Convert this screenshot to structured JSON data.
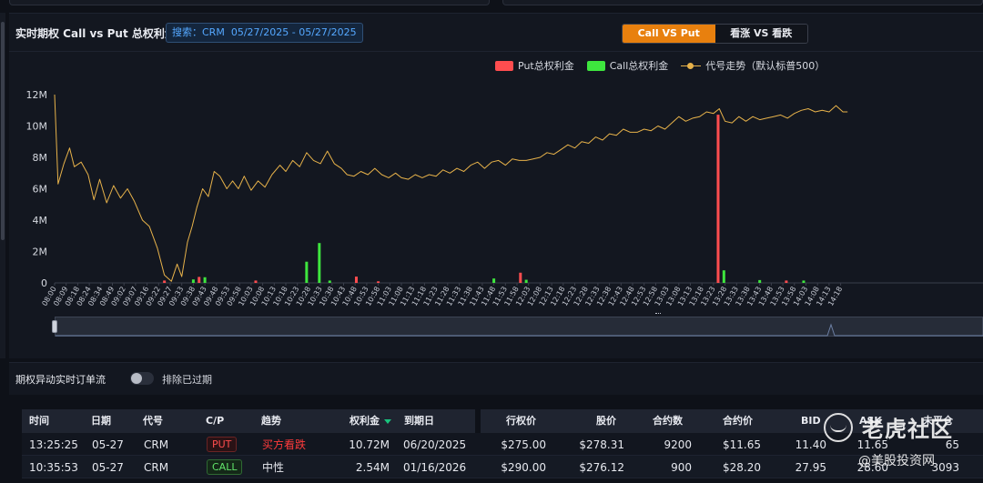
{
  "panel": {
    "title": "实时期权 Call vs Put 总权利金",
    "search_label": "搜索：CRM",
    "date_range": "05/27/2025 - 05/27/2025",
    "seg_active": "Call VS Put",
    "seg_inactive": "看涨 VS 看跌"
  },
  "legend": {
    "put": "Put总权利金",
    "call": "Call总权利金",
    "stock": "代号走势（默认标普500）"
  },
  "colors": {
    "put": "#ff4d4f",
    "call": "#3ee63e",
    "stock": "#e7b24a",
    "accent": "#e8800e"
  },
  "chart_data": {
    "type": "bar",
    "y_ticks": [
      "0",
      "2M",
      "4M",
      "6M",
      "8M",
      "10M",
      "12M"
    ],
    "ylim": [
      0,
      12000000
    ],
    "x_ticks": [
      "08:00",
      "08:09",
      "08:18",
      "08:24",
      "08:34",
      "08:49",
      "09:02",
      "09:07",
      "09:16",
      "09:22",
      "09:27",
      "09:33",
      "09:38",
      "09:43",
      "09:48",
      "09:53",
      "09:58",
      "10:03",
      "10:08",
      "10:13",
      "10:18",
      "10:23",
      "10:28",
      "10:33",
      "10:38",
      "10:43",
      "10:48",
      "10:53",
      "10:58",
      "11:03",
      "11:08",
      "11:13",
      "11:18",
      "11:23",
      "11:28",
      "11:33",
      "11:38",
      "11:43",
      "11:48",
      "11:53",
      "11:58",
      "12:03",
      "12:08",
      "12:13",
      "12:18",
      "12:23",
      "12:28",
      "12:33",
      "12:38",
      "12:43",
      "12:48",
      "12:53",
      "12:58",
      "13:03",
      "13:08",
      "13:13",
      "13:18",
      "13:23",
      "13:28",
      "13:33",
      "13:38",
      "13:43",
      "13:48",
      "13:53",
      "13:58",
      "14:03",
      "14:08",
      "14:13",
      "14:18"
    ],
    "series": [
      {
        "name": "Put总权利金",
        "points": [
          [
            9.5,
            150000
          ],
          [
            12.5,
            380000
          ],
          [
            17.4,
            150000
          ],
          [
            26.1,
            400000
          ],
          [
            28.0,
            100000
          ],
          [
            40.3,
            650000
          ],
          [
            57.4,
            10720000
          ],
          [
            63.3,
            150000
          ]
        ]
      },
      {
        "name": "Call总权利金",
        "points": [
          [
            12.0,
            220000
          ],
          [
            13.0,
            360000
          ],
          [
            21.8,
            1350000
          ],
          [
            22.9,
            2540000
          ],
          [
            23.8,
            150000
          ],
          [
            38.0,
            280000
          ],
          [
            40.8,
            200000
          ],
          [
            57.9,
            800000
          ],
          [
            61.0,
            180000
          ],
          [
            64.8,
            150000
          ]
        ]
      },
      {
        "name": "代号走势（默认标普500）",
        "points": [
          [
            0,
            12.0
          ],
          [
            0.3,
            6.3
          ],
          [
            0.8,
            7.6
          ],
          [
            1.3,
            8.6
          ],
          [
            1.7,
            7.4
          ],
          [
            2.3,
            7.7
          ],
          [
            2.9,
            6.9
          ],
          [
            3.4,
            5.3
          ],
          [
            3.9,
            6.6
          ],
          [
            4.5,
            5.1
          ],
          [
            5.1,
            6.2
          ],
          [
            5.7,
            5.4
          ],
          [
            6.3,
            6.0
          ],
          [
            6.9,
            5.2
          ],
          [
            7.6,
            4.0
          ],
          [
            8.2,
            3.6
          ],
          [
            8.9,
            2.2
          ],
          [
            9.5,
            0.5
          ],
          [
            10.1,
            0.1
          ],
          [
            10.6,
            1.2
          ],
          [
            11.0,
            0.4
          ],
          [
            11.5,
            2.6
          ],
          [
            11.9,
            3.6
          ],
          [
            12.3,
            4.8
          ],
          [
            12.8,
            6.0
          ],
          [
            13.3,
            5.5
          ],
          [
            13.8,
            7.1
          ],
          [
            14.3,
            6.8
          ],
          [
            14.9,
            6.0
          ],
          [
            15.4,
            6.5
          ],
          [
            15.9,
            6.0
          ],
          [
            16.4,
            6.8
          ],
          [
            17.0,
            5.9
          ],
          [
            17.6,
            6.5
          ],
          [
            18.2,
            6.1
          ],
          [
            18.8,
            6.9
          ],
          [
            19.5,
            7.5
          ],
          [
            20.0,
            7.1
          ],
          [
            20.6,
            7.8
          ],
          [
            21.2,
            7.4
          ],
          [
            21.8,
            8.3
          ],
          [
            22.4,
            7.8
          ],
          [
            23.0,
            7.6
          ],
          [
            23.6,
            8.4
          ],
          [
            24.2,
            7.6
          ],
          [
            24.8,
            7.3
          ],
          [
            25.3,
            6.9
          ],
          [
            25.9,
            6.8
          ],
          [
            26.5,
            7.1
          ],
          [
            27.1,
            6.9
          ],
          [
            27.7,
            7.3
          ],
          [
            28.3,
            6.9
          ],
          [
            28.9,
            6.7
          ],
          [
            29.5,
            7.0
          ],
          [
            30.0,
            6.7
          ],
          [
            30.6,
            6.6
          ],
          [
            31.2,
            6.9
          ],
          [
            31.8,
            6.7
          ],
          [
            32.4,
            6.9
          ],
          [
            33.0,
            6.8
          ],
          [
            33.6,
            7.2
          ],
          [
            34.2,
            7.0
          ],
          [
            34.8,
            7.3
          ],
          [
            35.4,
            7.1
          ],
          [
            36.0,
            7.5
          ],
          [
            36.6,
            7.7
          ],
          [
            37.2,
            7.3
          ],
          [
            37.8,
            7.7
          ],
          [
            38.4,
            7.8
          ],
          [
            39.0,
            7.5
          ],
          [
            39.6,
            7.9
          ],
          [
            40.2,
            7.8
          ],
          [
            40.8,
            7.8
          ],
          [
            41.4,
            7.9
          ],
          [
            42.0,
            8.0
          ],
          [
            42.6,
            8.3
          ],
          [
            43.2,
            8.2
          ],
          [
            43.8,
            8.5
          ],
          [
            44.4,
            8.8
          ],
          [
            45.0,
            8.6
          ],
          [
            45.6,
            9.0
          ],
          [
            46.2,
            8.9
          ],
          [
            46.8,
            9.3
          ],
          [
            47.4,
            9.1
          ],
          [
            48.0,
            9.5
          ],
          [
            48.6,
            9.4
          ],
          [
            49.2,
            9.8
          ],
          [
            49.8,
            9.6
          ],
          [
            50.4,
            9.6
          ],
          [
            51.0,
            9.8
          ],
          [
            51.6,
            9.7
          ],
          [
            52.2,
            10.0
          ],
          [
            52.8,
            9.8
          ],
          [
            53.4,
            10.2
          ],
          [
            54.0,
            10.6
          ],
          [
            54.6,
            10.3
          ],
          [
            55.2,
            10.5
          ],
          [
            55.8,
            10.6
          ],
          [
            56.4,
            10.9
          ],
          [
            57.0,
            10.8
          ],
          [
            57.5,
            11.1
          ],
          [
            58.0,
            10.3
          ],
          [
            58.6,
            10.2
          ],
          [
            59.2,
            10.6
          ],
          [
            59.8,
            10.3
          ],
          [
            60.4,
            10.6
          ],
          [
            61.0,
            10.4
          ],
          [
            61.6,
            10.5
          ],
          [
            62.2,
            10.6
          ],
          [
            62.8,
            10.7
          ],
          [
            63.4,
            10.5
          ],
          [
            64.0,
            10.8
          ],
          [
            64.6,
            11.0
          ],
          [
            65.2,
            11.1
          ],
          [
            65.8,
            10.9
          ],
          [
            66.4,
            11.0
          ],
          [
            67.0,
            10.9
          ],
          [
            67.6,
            11.3
          ],
          [
            68.2,
            10.9
          ],
          [
            68.6,
            10.9
          ]
        ]
      }
    ]
  },
  "orders": {
    "title": "期权异动实时订单流",
    "toggle_label": "排除已过期"
  },
  "table": {
    "headers": {
      "time": "时间",
      "date": "日期",
      "code": "代号",
      "cp": "C/P",
      "trend": "趋势",
      "premium": "权利金",
      "expiry": "到期日",
      "strike": "行权价",
      "stock_price": "股价",
      "contracts": "合约数",
      "contract_price": "合约价",
      "bid": "BID",
      "ask": "ASK",
      "oi": "未平仓"
    },
    "rows": [
      {
        "time": "13:25:25",
        "date": "05-27",
        "code": "CRM",
        "cp": "PUT",
        "trend": "买方看跌",
        "premium": "10.72M",
        "expiry": "06/20/2025",
        "strike": "$275.00",
        "stock_price": "$278.31",
        "contracts": "9200",
        "contract_price": "$11.65",
        "bid": "11.40",
        "ask": "11.65",
        "oi": "65"
      },
      {
        "time": "10:35:53",
        "date": "05-27",
        "code": "CRM",
        "cp": "CALL",
        "trend": "中性",
        "premium": "2.54M",
        "expiry": "01/16/2026",
        "strike": "$290.00",
        "stock_price": "$276.12",
        "contracts": "900",
        "contract_price": "$28.20",
        "bid": "27.95",
        "ask": "28.60",
        "oi": "3093"
      }
    ]
  },
  "watermark": {
    "main": "老虎社区",
    "sub": "@美股投资网"
  }
}
